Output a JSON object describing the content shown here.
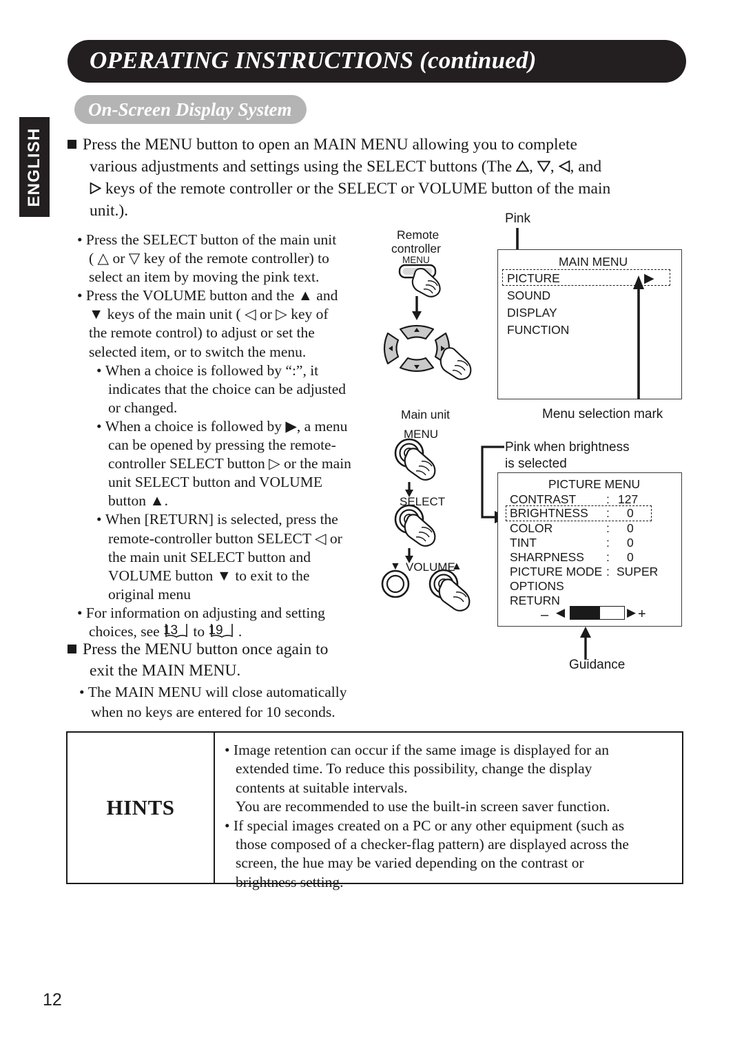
{
  "header": {
    "title": "OPERATING INSTRUCTIONS (continued)",
    "subtitle": "On-Screen Display System"
  },
  "sidebar": {
    "language_tab": "ENGLISH"
  },
  "page": {
    "number": "12"
  },
  "lead_paragraph": {
    "line1": "Press the MENU button to open an MAIN MENU allowing you to complete",
    "line2a": "various adjustments and settings using the SELECT buttons (The ",
    "line2b": ", ",
    "line2c": ", ",
    "line2d": ", and",
    "line3a": " keys of the remote controller or the SELECT or VOLUME button of the main",
    "line4": "unit.)."
  },
  "bullets": [
    {
      "id": "select-button",
      "level": 1,
      "lines": [
        "Press the SELECT button of the main unit",
        "( △ or ▽ key of the remote controller) to",
        "select an item by moving the pink text."
      ]
    },
    {
      "id": "volume-button",
      "level": 1,
      "lines": [
        "Press the VOLUME button and the ▲ and",
        "▼ keys of the main unit ( ◁ or ▷ key of",
        "the remote control) to adjust or set the",
        "selected item, or to switch the menu."
      ]
    },
    {
      "id": "colon-choice",
      "level": 2,
      "lines": [
        "When a choice is followed by “:”, it",
        "indicates that the choice can be adjusted",
        "or changed."
      ]
    },
    {
      "id": "arrow-choice",
      "level": 2,
      "lines": [
        "When a choice is followed by ▶, a menu",
        "can be opened by pressing the remote-",
        "controller SELECT button ▷ or the main",
        "unit SELECT button and VOLUME",
        "button ▲."
      ]
    },
    {
      "id": "return-selected",
      "level": 2,
      "lines": [
        "When [RETURN] is selected, press the",
        "remote-controller button SELECT ◁ or",
        "the main unit SELECT button and",
        "VOLUME button ▼ to exit to the",
        "original menu"
      ]
    }
  ],
  "page_ref_bullet": {
    "line1": "For information on adjusting and setting",
    "line2_prefix": "choices, see ",
    "ref_from": "13",
    "ref_to": "19",
    "connector": " to ",
    "line2_suffix": " ."
  },
  "exit_paragraph": {
    "line1": "Press the MENU button once again to",
    "line2": "exit the MAIN MENU.",
    "sub_line1": "The MAIN MENU will close automatically",
    "sub_line2": "when no keys are entered for 10 seconds."
  },
  "hints": {
    "label": "HINTS",
    "items": [
      "Image retention can occur if the same image is displayed for an",
      "extended time. To reduce this possibility, change the display",
      "contents at suitable intervals.",
      "You are recommended to use the built-in screen saver function.",
      "If special images created on a PC or any other equipment (such as",
      "those composed of a checker-flag pattern) are displayed across the",
      "screen, the hue may be varied depending on the contrast or",
      "brightness setting."
    ]
  },
  "diagram": {
    "remote": {
      "label_line1": "Remote",
      "label_line2": "controller",
      "menu_button": "MENU"
    },
    "main_unit": {
      "label": "Main unit",
      "menu_button": "MENU",
      "select_button": "SELECT",
      "volume_label": "VOLUME",
      "volume_down_glyph": "▼",
      "volume_up_glyph": "▲"
    },
    "callouts": {
      "pink": "Pink",
      "menu_selection_mark": "Menu selection mark",
      "pink_brightness_line1": "Pink when brightness",
      "pink_brightness_line2": "is selected",
      "guidance": "Guidance"
    },
    "main_menu": {
      "title": "MAIN MENU",
      "items": [
        {
          "label": "PICTURE",
          "selected": true,
          "submenu_arrow": "▶"
        },
        {
          "label": "SOUND",
          "selected": false,
          "submenu_arrow": ""
        },
        {
          "label": "DISPLAY",
          "selected": false,
          "submenu_arrow": ""
        },
        {
          "label": "FUNCTION",
          "selected": false,
          "submenu_arrow": ""
        }
      ]
    },
    "picture_menu": {
      "title": "PICTURE MENU",
      "rows": [
        {
          "label": "CONTRAST",
          "sep": ":",
          "value": "127",
          "selected": false
        },
        {
          "label": "BRIGHTNESS",
          "sep": ":",
          "value": "0",
          "selected": true
        },
        {
          "label": "COLOR",
          "sep": ":",
          "value": "0",
          "selected": false
        },
        {
          "label": "TINT",
          "sep": ":",
          "value": "0",
          "selected": false
        },
        {
          "label": "SHARPNESS",
          "sep": ":",
          "value": "0",
          "selected": false
        },
        {
          "label": "PICTURE MODE",
          "sep": ":",
          "value": "SUPER",
          "selected": false
        },
        {
          "label": "OPTIONS",
          "sep": "",
          "value": "",
          "selected": false
        },
        {
          "label": "RETURN",
          "sep": "",
          "value": "",
          "selected": false
        }
      ],
      "guidance_bar": {
        "minus": "–",
        "plus": "+",
        "left_arrow": "◀",
        "right_arrow": "▶",
        "fill_percent": 55
      }
    }
  },
  "colors": {
    "ink": "#1a1a1a",
    "header_bg": "#231f20",
    "subtitle_bg": "#b4b4b4",
    "button_gray": "#c9c9c9"
  }
}
